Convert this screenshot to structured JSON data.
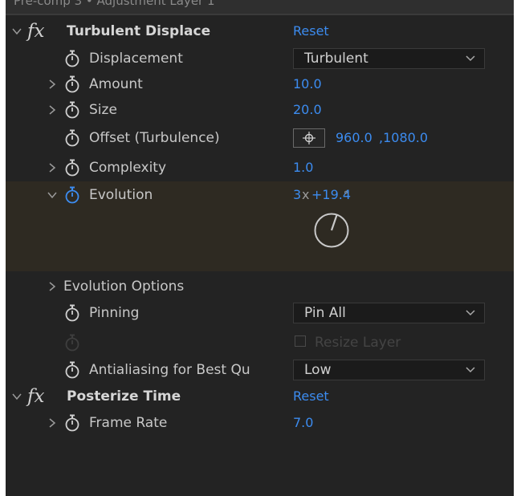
{
  "panel_title": "Pre-comp 3 • Adjustment Layer 1",
  "effects": [
    {
      "name": "Turbulent Displace",
      "reset_label": "Reset",
      "properties": {
        "displacement": {
          "label": "Displacement",
          "value": "Turbulent"
        },
        "amount": {
          "label": "Amount",
          "value": "10.0"
        },
        "size": {
          "label": "Size",
          "value": "20.0"
        },
        "offset": {
          "label": "Offset (Turbulence)",
          "value_x": "960.0",
          "value_y": ",1080.0"
        },
        "complexity": {
          "label": "Complexity",
          "value": "1.0"
        },
        "evolution": {
          "label": "Evolution",
          "revolutions": "3",
          "times": "x",
          "degrees": "+19.4",
          "degree_symbol": "°"
        },
        "evolution_options": {
          "label": "Evolution Options"
        },
        "pinning": {
          "label": "Pinning",
          "value": "Pin All"
        },
        "resize_layer": {
          "label": "Resize Layer",
          "checked": false
        },
        "antialiasing": {
          "label": "Antialiasing for Best Qu",
          "value": "Low"
        }
      }
    },
    {
      "name": "Posterize Time",
      "reset_label": "Reset",
      "properties": {
        "frame_rate": {
          "label": "Frame Rate",
          "value": "7.0"
        }
      }
    }
  ],
  "colors": {
    "panel_bg": "#232323",
    "value_blue": "#3c8cf0",
    "evolution_highlight": "#2e2a22",
    "text": "#c8c8c8"
  },
  "icons": {
    "stopwatch": "stopwatch-icon",
    "twirl": "chevron-icon",
    "fx": "fx-icon",
    "crosshair": "crosshair-icon"
  }
}
